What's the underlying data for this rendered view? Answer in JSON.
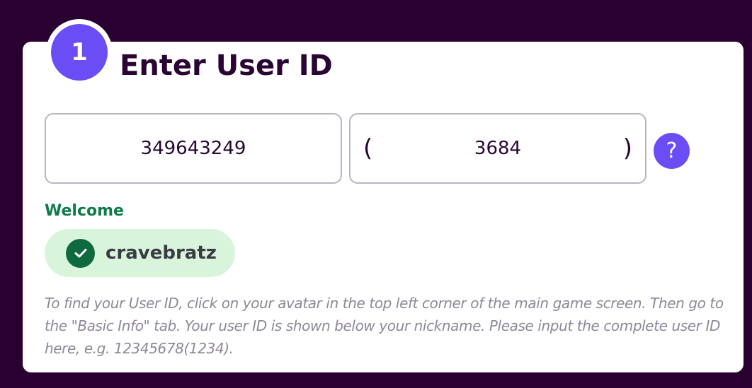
{
  "step": {
    "number": "1",
    "title": "Enter User ID"
  },
  "form": {
    "user_id_value": "349643249",
    "server_value": "3684",
    "paren_open": "(",
    "paren_close": ")",
    "help_label": "?"
  },
  "welcome": {
    "label": "Welcome",
    "username": "cravebratz"
  },
  "hint": "To find your User ID, click on your avatar in the top left corner of the main game screen. Then go to the \"Basic Info\" tab. Your user ID is shown below your nickname. Please input the complete user ID here, e.g. 12345678(1234).",
  "colors": {
    "page_background": "#2a0030",
    "accent": "#6a4df5",
    "success": "#0f7a4a",
    "success_bg": "#d8f5dc"
  },
  "icons": {
    "help": "question-mark-icon",
    "verified": "check-circle-icon"
  }
}
